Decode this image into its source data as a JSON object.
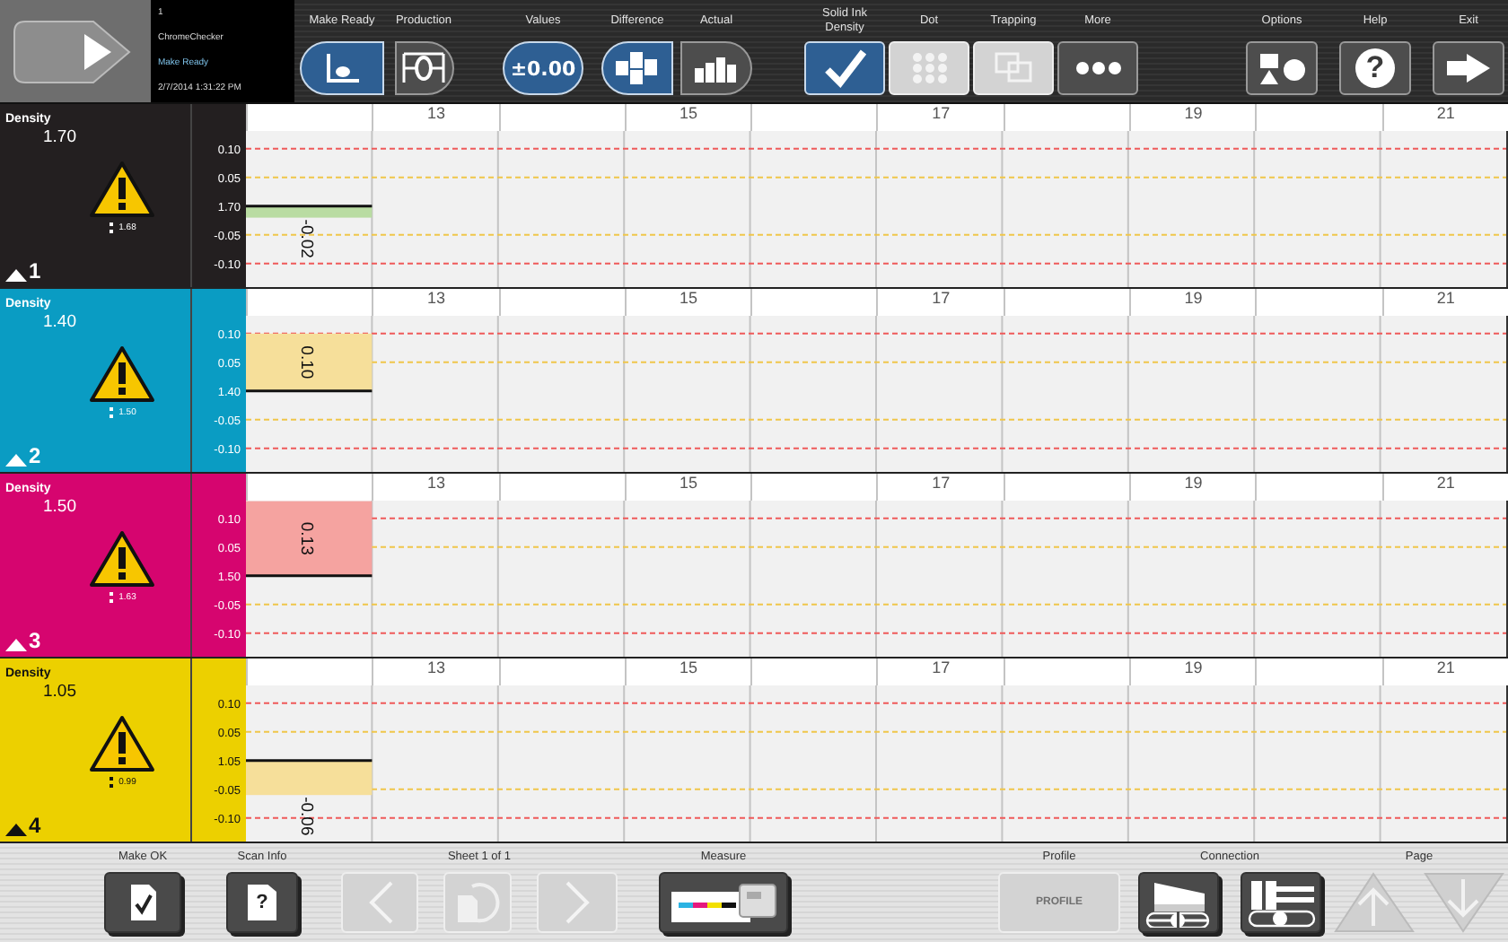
{
  "header": {
    "session": "1",
    "app_name": "ChromeChecker",
    "mode": "Make Ready",
    "timestamp": "2/7/2014 1:31:22 PM"
  },
  "toolbar": {
    "groups": [
      {
        "kind": "pill",
        "buttons": [
          {
            "label": "Make Ready",
            "kind": "scatter",
            "selected": true,
            "disabled": false
          },
          {
            "label": "Production",
            "kind": "gauge",
            "selected": false,
            "disabled": false
          }
        ]
      },
      {
        "kind": "pill",
        "buttons": [
          {
            "label": "Values",
            "kind": "text",
            "text": "±0.00",
            "selected": true,
            "disabled": false
          }
        ]
      },
      {
        "kind": "pill",
        "buttons": [
          {
            "label": "Difference",
            "kind": "checker",
            "selected": true,
            "disabled": false
          },
          {
            "label": "Actual",
            "kind": "bars",
            "selected": false,
            "disabled": false
          }
        ]
      },
      {
        "kind": "square",
        "buttons": [
          {
            "label": "Solid Ink Density",
            "kind": "check",
            "selected": true,
            "disabled": false
          },
          {
            "label": "Dot",
            "kind": "dots",
            "selected": false,
            "disabled": true
          },
          {
            "label": "Trapping",
            "kind": "overlap",
            "selected": false,
            "disabled": true
          },
          {
            "label": "More",
            "kind": "ellipsis",
            "selected": false,
            "disabled": false
          }
        ]
      },
      {
        "kind": "square",
        "buttons": [
          {
            "label": "Options",
            "kind": "shapes",
            "selected": false,
            "disabled": false
          },
          {
            "label": "Help",
            "kind": "glyph",
            "glyph": "?",
            "selected": false,
            "disabled": false
          },
          {
            "label": "Exit",
            "kind": "exit",
            "selected": false,
            "disabled": false
          }
        ]
      }
    ]
  },
  "channels": [
    {
      "color": "#231f20",
      "label": "Density",
      "value": "1.70",
      "reading": "1.68",
      "number": "1",
      "target_label": "1.70",
      "zone_labels": [
        "13",
        "15",
        "17",
        "19",
        "21"
      ],
      "chart_data": {
        "type": "bar",
        "series": [
          {
            "color": "#b9dca2",
            "values": [
              -0.02
            ]
          }
        ],
        "ylim": [
          -0.141,
          0.131
        ],
        "yticks": [
          {
            "value": 0.1,
            "label": "0.10"
          },
          {
            "value": 0.05,
            "label": "0.05"
          },
          {
            "value": -0.05,
            "label": "-0.05"
          },
          {
            "value": -0.1,
            "label": "-0.10"
          }
        ],
        "grid": true,
        "value_labels": [
          "-0.02"
        ]
      }
    },
    {
      "color": "#0a9cc3",
      "label": "Density",
      "value": "1.40",
      "reading": "1.50",
      "number": "2",
      "target_label": "1.40",
      "zone_labels": [
        "13",
        "15",
        "17",
        "19",
        "21"
      ],
      "chart_data": {
        "type": "bar",
        "series": [
          {
            "color": "#f6df9a",
            "values": [
              0.1
            ]
          }
        ],
        "ylim": [
          -0.141,
          0.131
        ],
        "yticks": [
          {
            "value": 0.1,
            "label": "0.10"
          },
          {
            "value": 0.05,
            "label": "0.05"
          },
          {
            "value": -0.05,
            "label": "-0.05"
          },
          {
            "value": -0.1,
            "label": "-0.10"
          }
        ],
        "grid": true,
        "value_labels": [
          "0.10"
        ]
      }
    },
    {
      "color": "#d6056f",
      "label": "Density",
      "value": "1.50",
      "reading": "1.63",
      "number": "3",
      "target_label": "1.50",
      "zone_labels": [
        "13",
        "15",
        "17",
        "19",
        "21"
      ],
      "chart_data": {
        "type": "bar",
        "series": [
          {
            "color": "#f5a3a0",
            "values": [
              0.13
            ]
          }
        ],
        "ylim": [
          -0.141,
          0.131
        ],
        "yticks": [
          {
            "value": 0.1,
            "label": "0.10"
          },
          {
            "value": 0.05,
            "label": "0.05"
          },
          {
            "value": -0.05,
            "label": "-0.05"
          },
          {
            "value": -0.1,
            "label": "-0.10"
          }
        ],
        "grid": true,
        "value_labels": [
          "0.13"
        ]
      }
    },
    {
      "color": "#ecd000",
      "label": "Density",
      "value": "1.05",
      "reading": "0.99",
      "number": "4",
      "target_label": "1.05",
      "zone_labels": [
        "13",
        "15",
        "17",
        "19",
        "21"
      ],
      "chart_data": {
        "type": "bar",
        "series": [
          {
            "color": "#f6df9a",
            "values": [
              -0.06
            ]
          }
        ],
        "ylim": [
          -0.141,
          0.131
        ],
        "yticks": [
          {
            "value": 0.1,
            "label": "0.10"
          },
          {
            "value": 0.05,
            "label": "0.05"
          },
          {
            "value": -0.05,
            "label": "-0.05"
          },
          {
            "value": -0.1,
            "label": "-0.10"
          }
        ],
        "grid": true,
        "value_labels": [
          "-0.06"
        ]
      }
    }
  ],
  "bottom_bar": {
    "groups": [
      {
        "label": "Make OK",
        "buttons": [
          {
            "kind": "doc-check",
            "disabled": false
          }
        ]
      },
      {
        "label": "Scan Info",
        "buttons": [
          {
            "kind": "doc-glyph",
            "glyph": "?",
            "disabled": false
          }
        ]
      },
      {
        "label": "Sheet 1 of 1",
        "buttons": [
          {
            "kind": "chevron-left",
            "disabled": true
          },
          {
            "kind": "refresh",
            "disabled": true
          },
          {
            "kind": "chevron-right",
            "disabled": true
          }
        ]
      },
      {
        "label": "Measure",
        "buttons": [
          {
            "kind": "measure",
            "disabled": false
          }
        ]
      },
      {
        "label": "Profile",
        "buttons": [
          {
            "kind": "text",
            "text": "PROFILE",
            "disabled": true
          }
        ]
      },
      {
        "label": "Connection",
        "buttons": [
          {
            "kind": "device-a",
            "disabled": false
          },
          {
            "kind": "device-b",
            "disabled": false
          }
        ]
      },
      {
        "label": "Page",
        "buttons": [
          {
            "kind": "arrow-up",
            "disabled": true
          },
          {
            "kind": "arrow-down",
            "disabled": true
          }
        ]
      }
    ]
  }
}
